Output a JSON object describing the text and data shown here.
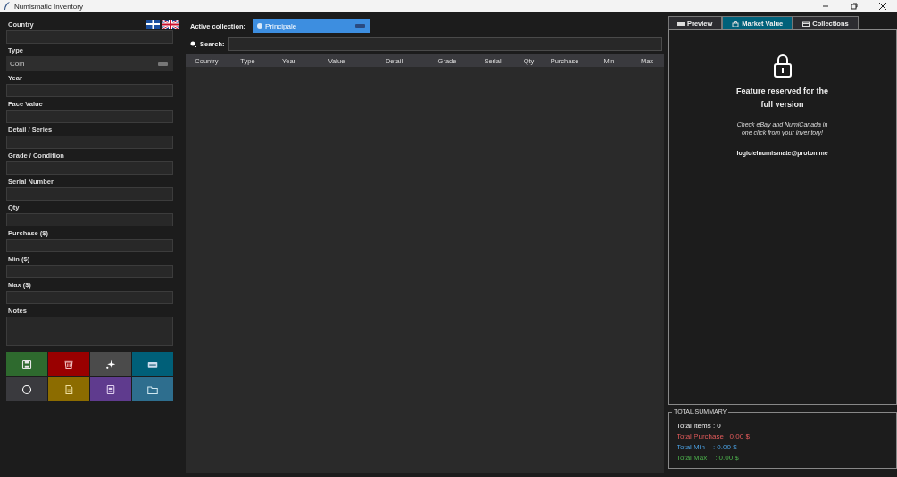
{
  "window": {
    "title": "Numismatic Inventory"
  },
  "form": {
    "fields": [
      {
        "label": "Country",
        "kind": "text"
      },
      {
        "label": "Type",
        "kind": "combo",
        "value": "Coin"
      },
      {
        "label": "Year",
        "kind": "text"
      },
      {
        "label": "Face Value",
        "kind": "text"
      },
      {
        "label": "Detail / Series",
        "kind": "text"
      },
      {
        "label": "Grade / Condition",
        "kind": "text"
      },
      {
        "label": "Serial Number",
        "kind": "text"
      },
      {
        "label": "Qty",
        "kind": "text"
      },
      {
        "label": "Purchase ($)",
        "kind": "text"
      },
      {
        "label": "Min ($)",
        "kind": "text"
      },
      {
        "label": "Max ($)",
        "kind": "text"
      },
      {
        "label": "Notes",
        "kind": "textarea"
      }
    ],
    "buttons": [
      {
        "kind": "save",
        "color": "#2e6a2e"
      },
      {
        "kind": "delete",
        "color": "#990000"
      },
      {
        "kind": "new",
        "color": "#4b4b4b"
      },
      {
        "kind": "card",
        "color": "#005f78"
      },
      {
        "kind": "reset",
        "color": "#3a3a3e"
      },
      {
        "kind": "document",
        "color": "#8c6c00"
      },
      {
        "kind": "report",
        "color": "#5f3b8e"
      },
      {
        "kind": "folder",
        "color": "#2e6e8e"
      }
    ]
  },
  "collection": {
    "label": "Active collection:",
    "value": "Principale"
  },
  "search": {
    "label": "Search:"
  },
  "table": {
    "columns": [
      "Country",
      "Type",
      "Year",
      "Value",
      "Detail",
      "Grade",
      "Serial",
      "Qty",
      "Purchase",
      "Min",
      "Max"
    ]
  },
  "tabs": [
    {
      "label": "Preview",
      "selected": false
    },
    {
      "label": "Market Value",
      "selected": true
    },
    {
      "label": "Collections",
      "selected": false
    }
  ],
  "market": {
    "heading": "Feature reserved for the full version",
    "note": "Check eBay and NumiCanada in one click from your inventory!",
    "email": "logicielnumismate@proton.me"
  },
  "summary": {
    "title": "TOTAL SUMMARY",
    "lines": [
      {
        "text": "Total Items : 0",
        "kind": "count"
      },
      {
        "text": "Total Purchase : 0.00 $",
        "kind": "purchase"
      },
      {
        "text": "Total Min    : 0.00 $",
        "kind": "min"
      },
      {
        "text": "Total Max    : 0.00 $",
        "kind": "max"
      }
    ]
  }
}
